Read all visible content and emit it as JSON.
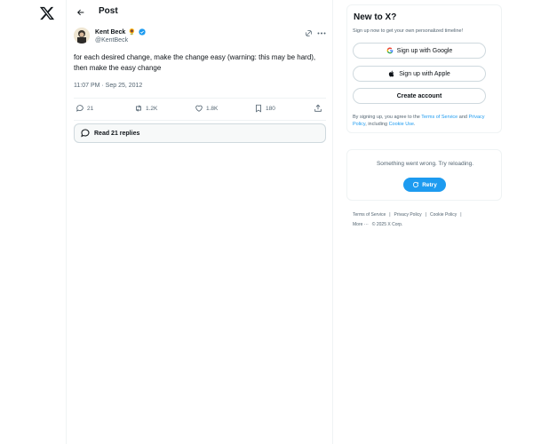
{
  "nav": {
    "logo_icon": "x-logo-icon"
  },
  "header": {
    "back_icon": "arrow-left-icon",
    "title": "Post"
  },
  "tweet": {
    "author_name": "Kent Beck",
    "author_emoji": "🌻",
    "verified_icon": "verified-badge-icon",
    "handle": "@KentBeck",
    "text": "for each desired change, make the change easy (warning: this may be hard), then make the easy change",
    "timestamp": "11:07 PM · Sep 25, 2012",
    "actions": {
      "replies": "21",
      "reposts": "1.2K",
      "likes": "1.8K",
      "bookmarks": "180"
    }
  },
  "read_replies": {
    "label": "Read 21 replies"
  },
  "signup": {
    "title": "New to X?",
    "subtitle": "Sign up now to get your own personalized timeline!",
    "google_label": "Sign up with Google",
    "apple_label": "Sign up with Apple",
    "create_label": "Create account",
    "legal_prefix": "By signing up, you agree to the ",
    "legal_terms": "Terms of Service",
    "legal_and": " and",
    "legal_privacy": "Privacy Policy",
    "legal_including": ", including ",
    "legal_cookie": "Cookie Use",
    "legal_end": "."
  },
  "error_card": {
    "message": "Something went wrong. Try reloading.",
    "retry_label": "Retry"
  },
  "footer": {
    "terms": "Terms of Service",
    "privacy": "Privacy Policy",
    "cookie": "Cookie Policy",
    "more": "More ···",
    "copyright": "© 2025 X Corp."
  },
  "colors": {
    "accent": "#1d9bf0",
    "text": "#0f1419",
    "muted": "#536471",
    "border": "#eff3f4"
  }
}
